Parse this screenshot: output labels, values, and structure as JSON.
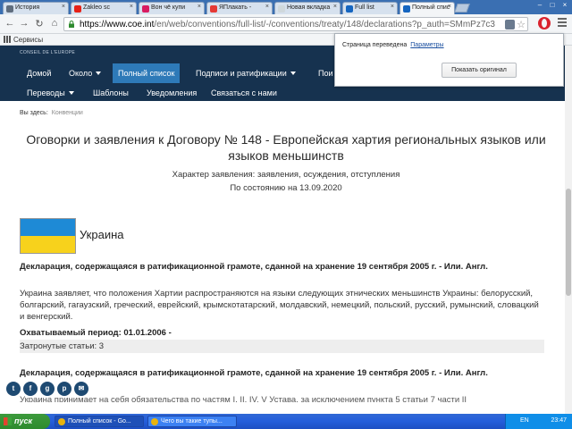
{
  "browser": {
    "tabs": [
      {
        "label": "История",
        "color": "#5f6d7e"
      },
      {
        "label": "Zakleo sc",
        "color": "#e62117"
      },
      {
        "label": "Вон чё купи",
        "color": "#d81b60"
      },
      {
        "label": "ЯПлакать -",
        "color": "#e53935"
      },
      {
        "label": "Новая вкладка",
        "color": "#cfd8dc"
      },
      {
        "label": "Full list",
        "color": "#1565c0"
      },
      {
        "label": "Полный спис",
        "color": "#1565c0"
      }
    ],
    "url_host": "https://www.coe.int",
    "url_rest": "/en/web/conventions/full-list/-/conventions/treaty/148/declarations?p_auth=SMmPz7c3",
    "bookmarks_apps": "Сервисы"
  },
  "translate_popup": {
    "message": "Страница переведена",
    "settings_link": "Параметры",
    "show_original": "Показать оригинал"
  },
  "site": {
    "logo": "CONSEIL DE L'EUROPE",
    "nav_row1": [
      {
        "label": "Домой",
        "caret": false
      },
      {
        "label": "Около",
        "caret": true
      },
      {
        "label": "Полный список",
        "caret": false
      },
      {
        "label": "Подписи и ратификации",
        "caret": true
      },
      {
        "label": "Пои",
        "caret": false
      }
    ],
    "nav_row2": [
      {
        "label": "Переводы",
        "caret": true
      },
      {
        "label": "Шаблоны",
        "caret": false
      },
      {
        "label": "Уведомления",
        "caret": false
      },
      {
        "label": "Связаться с нами",
        "caret": false
      }
    ]
  },
  "content": {
    "crumbs_label": "Вы здесь:",
    "crumbs_link": "Конвенции",
    "title": "Оговорки и заявления к Договору № 148 - Европейская хартия региональных языков или языков меньшинств",
    "nature": "Характер заявления: заявления, осуждения, отступления",
    "as_of": "По состоянию на 13.09.2020",
    "country": "Украина",
    "declaration1": "Декларация, содержащаяся в ратификационной грамоте, сданной на хранение 19 сентября 2005 г. - Или. Англ.",
    "body": "Украина заявляет, что положения Хартии распространяются на языки следующих этнических меньшинств Украины: белорусский, болгарский, гагаузский, греческий, еврейский, крымскотатарский, молдавский, немецкий, польский, русский, румынский, словацкий и венгерский.",
    "period": "Охватываемый период: 01.01.2006 -",
    "articles": "Затронутые статьи: 3",
    "declaration2": "Декларация, содержащаяся в ратификационной грамоте, сданной на хранение 19 сентября 2005 г. - Или. Англ.",
    "cut_text": "Украина принимает на себя обязательства по частям I, II, IV, V Устава, за исключением пункта 5 статьи 7 части II"
  },
  "share_icons": [
    "twitter-icon",
    "facebook-icon",
    "googleplus-icon",
    "pinterest-icon",
    "email-icon"
  ],
  "taskbar": {
    "start": "пуск",
    "items": [
      {
        "label": "Полный список - Go...",
        "active": true
      },
      {
        "label": "Чего вы такие тупы...",
        "active": false
      }
    ],
    "lang": "EN",
    "clock": "23:47"
  }
}
